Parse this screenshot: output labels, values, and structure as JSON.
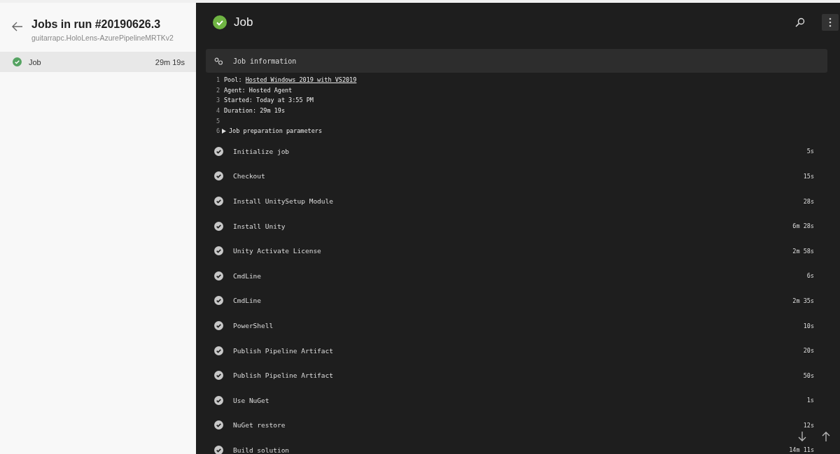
{
  "sidebar": {
    "title": "Jobs in run #20190626.3",
    "subtitle": "guitarrapc.HoloLens-AzurePipelineMRTKv2",
    "jobs": [
      {
        "name": "Job",
        "duration": "29m 19s",
        "succeeded": true,
        "selected": true
      }
    ]
  },
  "main": {
    "title": "Job",
    "succeeded": true,
    "job_information": {
      "title": "Job information",
      "lines": [
        {
          "number": "1",
          "label": "Pool: ",
          "link": "Hosted Windows 2019 with VS2019"
        },
        {
          "number": "2",
          "label": "Agent: Hosted Agent"
        },
        {
          "number": "3",
          "label": "Started: Today at 3:55 PM"
        },
        {
          "number": "4",
          "label": "Duration: 29m 19s"
        },
        {
          "number": "5"
        },
        {
          "number": "6",
          "label": "Job preparation parameters",
          "expandable": true
        }
      ]
    },
    "steps": [
      {
        "name": "Initialize job",
        "duration": "5s",
        "succeeded": true
      },
      {
        "name": "Checkout",
        "duration": "15s",
        "succeeded": true
      },
      {
        "name": "Install UnitySetup Module",
        "duration": "28s",
        "succeeded": true
      },
      {
        "name": "Install Unity",
        "duration": "6m 28s",
        "succeeded": true
      },
      {
        "name": "Unity Activate License",
        "duration": "2m 58s",
        "succeeded": true
      },
      {
        "name": "CmdLine",
        "duration": "6s",
        "succeeded": true
      },
      {
        "name": "CmdLine",
        "duration": "2m 35s",
        "succeeded": true
      },
      {
        "name": "PowerShell",
        "duration": "10s",
        "succeeded": true
      },
      {
        "name": "Publish Pipeline Artifact",
        "duration": "20s",
        "succeeded": true
      },
      {
        "name": "Publish Pipeline Artifact",
        "duration": "50s",
        "succeeded": true
      },
      {
        "name": "Use NuGet",
        "duration": "1s",
        "succeeded": true
      },
      {
        "name": "NuGet restore",
        "duration": "12s",
        "succeeded": true
      },
      {
        "name": "Build solution",
        "duration": "14m 11s",
        "succeeded": true
      }
    ]
  }
}
